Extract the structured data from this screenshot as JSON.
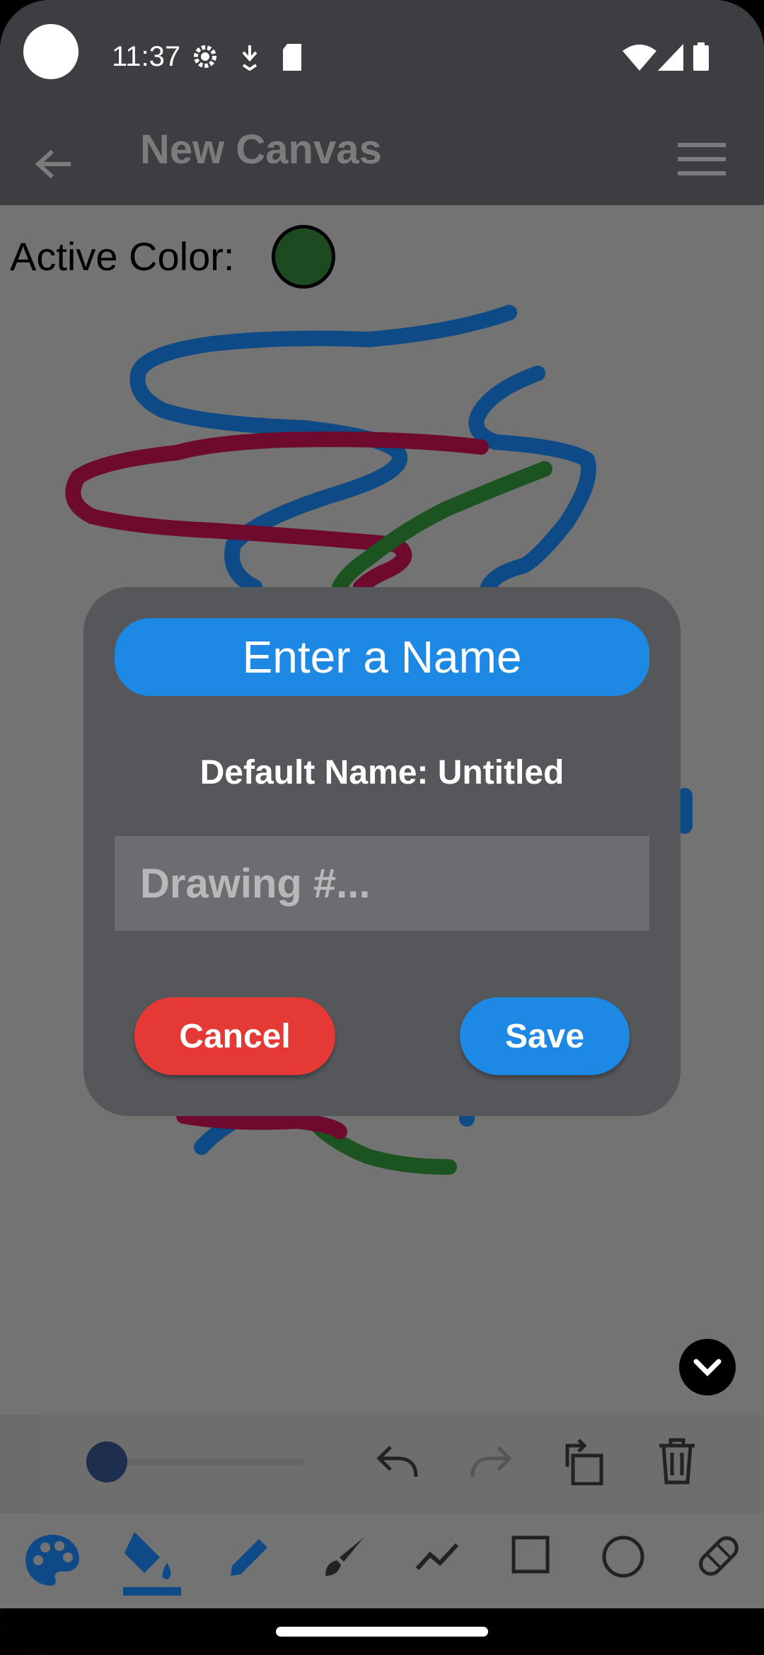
{
  "status_bar": {
    "time": "11:37",
    "left_icons": [
      "settings-gear-icon",
      "download-icon",
      "sd-card-icon"
    ],
    "right_icons": [
      "wifi-icon",
      "signal-icon",
      "battery-icon"
    ]
  },
  "app_bar": {
    "title": "New Canvas",
    "back_icon": "arrow-back-icon",
    "menu_icon": "hamburger-menu-icon"
  },
  "canvas": {
    "active_color_label": "Active Color:",
    "active_color": "#1d4a1f",
    "stroke_colors": [
      "#0e4a86",
      "#6e0a2e",
      "#1b5420"
    ]
  },
  "dialog": {
    "header": "Enter a Name",
    "default_name_text": "Default Name: Untitled",
    "input_value": "",
    "input_placeholder": "Drawing #...",
    "cancel_label": "Cancel",
    "save_label": "Save",
    "colors": {
      "header": "#1e88e5",
      "cancel": "#e53935",
      "save": "#1e88e5"
    }
  },
  "toolbar": {
    "brush_size_value": 0.05,
    "actions": [
      "undo-icon",
      "redo-icon",
      "rotate-icon",
      "delete-icon"
    ],
    "tools": [
      "palette-icon",
      "fill-bucket-icon",
      "pencil-icon",
      "brush-icon",
      "polyline-icon",
      "rectangle-icon",
      "circle-icon",
      "eraser-icon"
    ],
    "selected_tool": "fill-bucket-icon"
  }
}
